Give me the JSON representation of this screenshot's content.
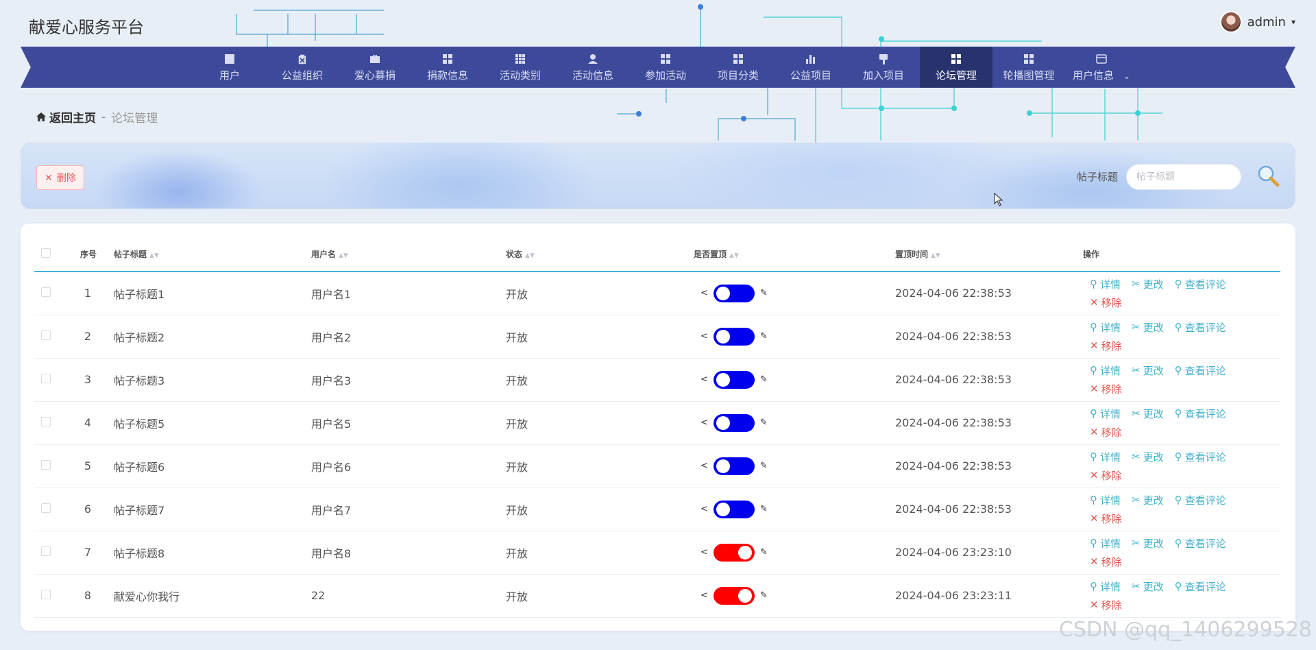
{
  "app": {
    "title": "献爱心服务平台"
  },
  "user": {
    "name": "admin"
  },
  "colors": {
    "nav_bg": "#3d4a9a",
    "nav_active": "#28336e",
    "accent": "#3fb3d9",
    "toggle_on": "#0000ee",
    "toggle_off": "#ff0000",
    "op_link": "#45b3cc",
    "danger": "#e2584e"
  },
  "nav": {
    "items": [
      {
        "label": "用户",
        "icon": "chart-icon"
      },
      {
        "label": "公益组织",
        "icon": "clipboard-icon"
      },
      {
        "label": "爱心募捐",
        "icon": "briefcase-icon"
      },
      {
        "label": "捐款信息",
        "icon": "grid-icon"
      },
      {
        "label": "活动类别",
        "icon": "apps-icon"
      },
      {
        "label": "活动信息",
        "icon": "person-icon"
      },
      {
        "label": "参加活动",
        "icon": "grid-icon"
      },
      {
        "label": "项目分类",
        "icon": "grid-icon"
      },
      {
        "label": "公益项目",
        "icon": "bar-chart-icon"
      },
      {
        "label": "加入项目",
        "icon": "brush-icon"
      },
      {
        "label": "论坛管理",
        "icon": "grid-icon"
      },
      {
        "label": "轮播图管理",
        "icon": "grid-icon"
      },
      {
        "label": "用户信息",
        "icon": "window-icon"
      }
    ],
    "active_index": 10
  },
  "breadcrumb": {
    "home": "返回主页",
    "separator": "-",
    "current": "论坛管理"
  },
  "toolbar": {
    "delete_label": "删除"
  },
  "search": {
    "label": "帖子标题",
    "placeholder": "帖子标题"
  },
  "table": {
    "headers": {
      "index": "序号",
      "title": "帖子标题",
      "user": "用户名",
      "status": "状态",
      "pinned": "是否置顶",
      "pin_time": "置顶时间",
      "actions": "操作"
    },
    "actions": {
      "detail": "详情",
      "edit": "更改",
      "comments": "查看评论",
      "remove": "移除"
    },
    "rows": [
      {
        "index": "1",
        "title": "帖子标题1",
        "user": "用户名1",
        "status": "开放",
        "pinned": true,
        "pin_time": "2024-04-06 22:38:53"
      },
      {
        "index": "2",
        "title": "帖子标题2",
        "user": "用户名2",
        "status": "开放",
        "pinned": true,
        "pin_time": "2024-04-06 22:38:53"
      },
      {
        "index": "3",
        "title": "帖子标题3",
        "user": "用户名3",
        "status": "开放",
        "pinned": true,
        "pin_time": "2024-04-06 22:38:53"
      },
      {
        "index": "4",
        "title": "帖子标题5",
        "user": "用户名5",
        "status": "开放",
        "pinned": true,
        "pin_time": "2024-04-06 22:38:53"
      },
      {
        "index": "5",
        "title": "帖子标题6",
        "user": "用户名6",
        "status": "开放",
        "pinned": true,
        "pin_time": "2024-04-06 22:38:53"
      },
      {
        "index": "6",
        "title": "帖子标题7",
        "user": "用户名7",
        "status": "开放",
        "pinned": true,
        "pin_time": "2024-04-06 22:38:53"
      },
      {
        "index": "7",
        "title": "帖子标题8",
        "user": "用户名8",
        "status": "开放",
        "pinned": false,
        "pin_time": "2024-04-06 23:23:10"
      },
      {
        "index": "8",
        "title": "献爱心你我行",
        "user": "22",
        "status": "开放",
        "pinned": false,
        "pin_time": "2024-04-06 23:23:11"
      }
    ]
  },
  "watermark": "CSDN @qq_1406299528"
}
